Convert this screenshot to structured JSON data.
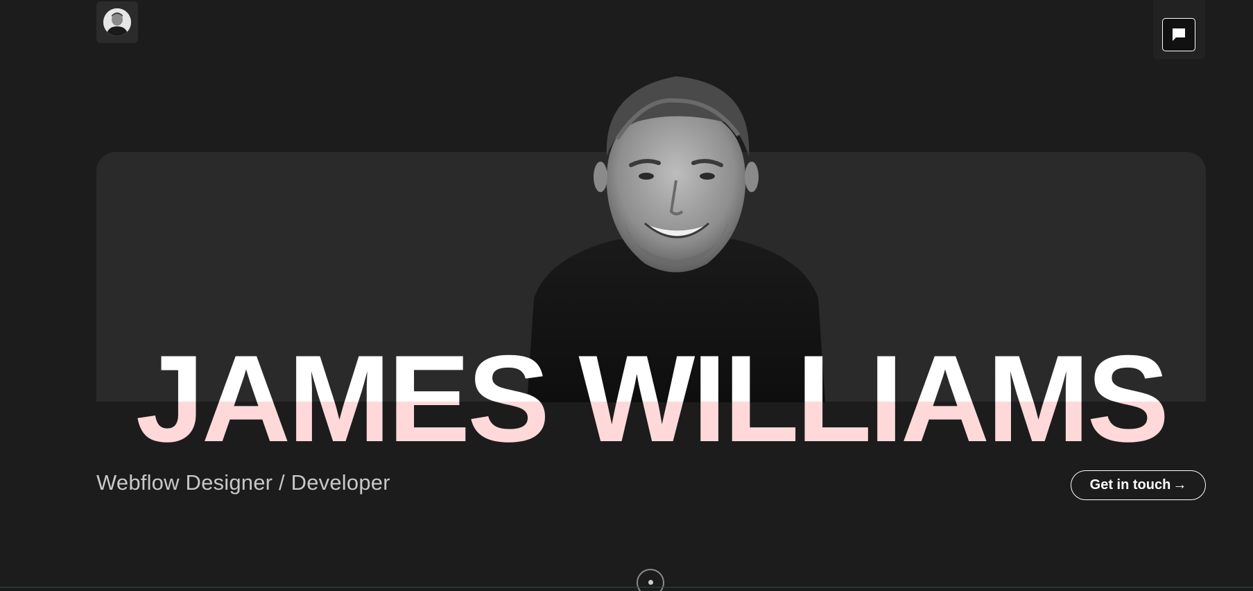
{
  "header": {
    "logo_icon": "avatar-icon",
    "chat_icon": "chat-bubble-icon"
  },
  "hero": {
    "name": "JAMES WILLIAMS",
    "subtitle": "Webflow Designer / Developer",
    "cta_label": "Get in touch",
    "cta_arrow": "→",
    "scroll_icon": "scroll-indicator-icon"
  },
  "colors": {
    "background": "#1c1c1c",
    "card": "#2a2a2a",
    "name_top": "#ffffff",
    "name_bottom": "#ffd9da",
    "subtitle": "#c8c8c8"
  }
}
